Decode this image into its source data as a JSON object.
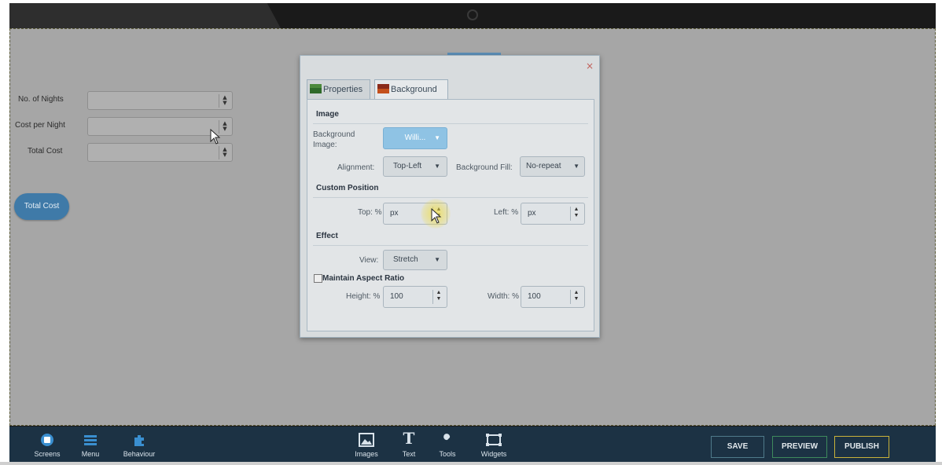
{
  "form": {
    "nights_label": "No. of Nights",
    "cost_label": "Cost per Night",
    "total_label": "Total Cost",
    "total_button": "Total Cost"
  },
  "dialog": {
    "close": "×",
    "tabs": {
      "properties": "Properties",
      "background": "Background"
    },
    "image_section": "Image",
    "bg_image_label": "Background Image:",
    "bg_image_value": "Willi...",
    "alignment_label": "Alignment:",
    "alignment_value": "Top-Left",
    "bg_fill_label": "Background Fill:",
    "bg_fill_value": "No-repeat",
    "custom_position_section": "Custom Position",
    "top_label": "Top: %",
    "top_value": "px",
    "left_label": "Left: %",
    "left_value": "px",
    "effect_section": "Effect",
    "view_label": "View:",
    "view_value": "Stretch",
    "maintain_aspect": "Maintain Aspect Ratio",
    "height_label": "Height: %",
    "height_value": "100",
    "width_label": "Width: %",
    "width_value": "100"
  },
  "toolbar": {
    "screens": "Screens",
    "menu": "Menu",
    "behaviour": "Behaviour",
    "images": "Images",
    "text": "Text",
    "tools": "Tools",
    "widgets": "Widgets",
    "save": "SAVE",
    "preview": "PREVIEW",
    "publish": "PUBLISH"
  },
  "colors": {
    "accent": "#3f7aa8",
    "toolbar_bg": "#1c3244",
    "publish_border": "#c9b23a",
    "preview_border": "#3e8a5c"
  }
}
